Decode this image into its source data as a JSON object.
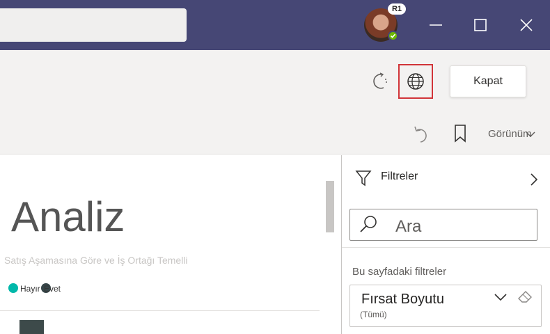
{
  "titlebar": {
    "badge": "R1",
    "background": "#464775",
    "presence_color": "#6bb700",
    "icons": [
      "minimize-icon",
      "maximize-icon",
      "close-window-icon"
    ]
  },
  "toolbar": {
    "close_label": "Kapat",
    "view_label": "Görünüm",
    "icons": [
      "refresh-icon",
      "globe-icon",
      "undo-icon",
      "bookmark-icon",
      "chevron-down-icon"
    ],
    "highlight_color": "#d13438"
  },
  "report": {
    "title": "Analiz",
    "subtitle": "Satış Aşamasına Göre ve İş Ortağı Temelli",
    "legend": [
      {
        "label": "Hayır",
        "color": "#01b8aa"
      },
      {
        "label": "Evet",
        "color": "#374649"
      }
    ]
  },
  "filters": {
    "title": "Filtreler",
    "search_placeholder": "Ara",
    "section_label": "Bu sayfadaki filtreler",
    "cards": [
      {
        "name": "Fırsat Boyutu",
        "value": "(Tümü)"
      }
    ]
  }
}
